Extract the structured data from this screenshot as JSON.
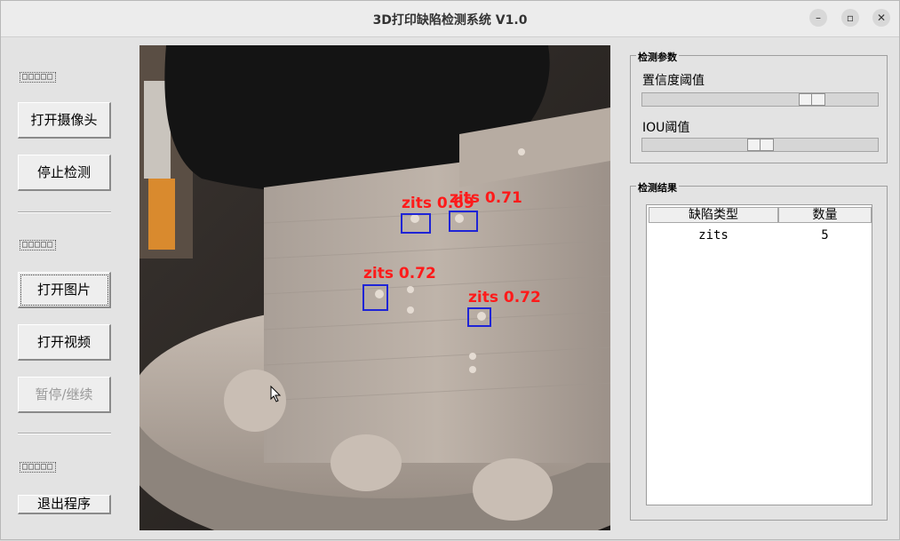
{
  "window": {
    "title": "3D打印缺陷检测系统 V1.0",
    "controls": {
      "minimize": "–",
      "maximize": "▫",
      "close": "✕"
    }
  },
  "sidebar": {
    "section_markers": [
      "□□□□□",
      "□□□□□",
      "□□□□□"
    ],
    "buttons": {
      "open_camera": "打开摄像头",
      "stop_detect": "停止检测",
      "open_image": "打开图片",
      "open_video": "打开视频",
      "pause_resume": "暂停/继续",
      "exit": "退出程序"
    }
  },
  "detection": {
    "boxes": [
      {
        "label": "zits 0.69"
      },
      {
        "label": "zits 0.71"
      },
      {
        "label": "zits 0.72"
      },
      {
        "label": "zits 0.72"
      }
    ]
  },
  "params": {
    "group_title": "检测参数",
    "confidence_label": "置信度阈值",
    "confidence_value": 0.75,
    "iou_label": "IOU阈值",
    "iou_value": 0.5
  },
  "results": {
    "group_title": "检测结果",
    "columns": [
      "缺陷类型",
      "数量"
    ],
    "rows": [
      {
        "type": "zits",
        "count": "5"
      }
    ]
  },
  "colors": {
    "box": "#1f24d6",
    "label": "#ff1a1a"
  }
}
